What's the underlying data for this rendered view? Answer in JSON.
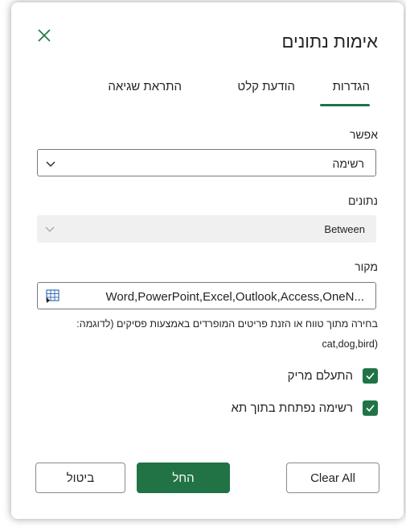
{
  "dialog": {
    "title": "אימות נתונים"
  },
  "tabs": [
    {
      "label": "הגדרות",
      "selected": true
    },
    {
      "label": "הודעת קלט",
      "selected": false
    },
    {
      "label": "התראת שגיאה",
      "selected": false
    }
  ],
  "allow": {
    "label": "אפשר",
    "value": "רשימה"
  },
  "data_field": {
    "label": "נתונים",
    "value": "Between",
    "disabled": true
  },
  "source": {
    "label": "מקור",
    "value": "Word,PowerPoint,Excel,Outlook,Access,OneN..."
  },
  "hint": {
    "line1": "בחירה מתוך טווח או הזנת פריטים המופרדים באמצעות פסיקים (לדוגמה:",
    "line2": "cat,dog,bird)"
  },
  "options": [
    {
      "label": "התעלם מריק",
      "checked": true
    },
    {
      "label": "רשימה נפתחת בתוך תא",
      "checked": true
    }
  ],
  "buttons": {
    "clear_all": "Clear All",
    "apply": "החל",
    "cancel": "ביטול"
  },
  "colors": {
    "accent": "#217346",
    "disabled_bg": "#f0f0f0",
    "border": "#7a7a7a"
  },
  "icons": [
    "close-icon",
    "chevron-down-icon",
    "range-select-icon",
    "checkmark-icon"
  ]
}
